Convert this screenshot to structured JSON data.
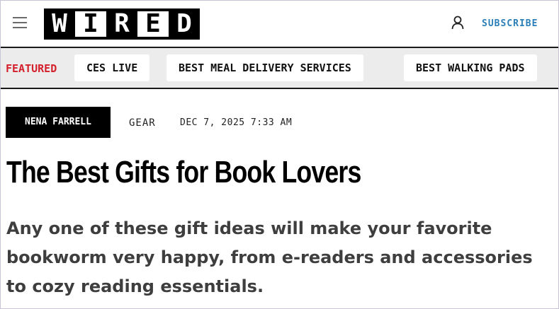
{
  "header": {
    "logo_letters": [
      "W",
      "I",
      "R",
      "E",
      "D"
    ],
    "subscribe_label": "SUBSCRIBE"
  },
  "nav": {
    "featured_label": "FEATURED",
    "items": [
      {
        "label": "CES LIVE"
      },
      {
        "label": "BEST MEAL DELIVERY SERVICES"
      },
      {
        "label": "BEST WALKING PADS"
      }
    ]
  },
  "article": {
    "author": "NENA FARRELL",
    "category": "GEAR",
    "date": "DEC 7, 2025 7:33 AM",
    "title": "The Best Gifts for Book Lovers",
    "dek": "Any one of these gift ideas will make your favorite bookworm very happy, from e-readers and accessories to cozy reading essentials."
  },
  "colors": {
    "featured_red": "#d4202c",
    "subscribe_blue": "#2a7fb8",
    "nav_background": "#ececec",
    "dek_text": "#3e3e3e"
  },
  "icons": {
    "menu": "hamburger-menu-icon",
    "account": "user-icon"
  }
}
